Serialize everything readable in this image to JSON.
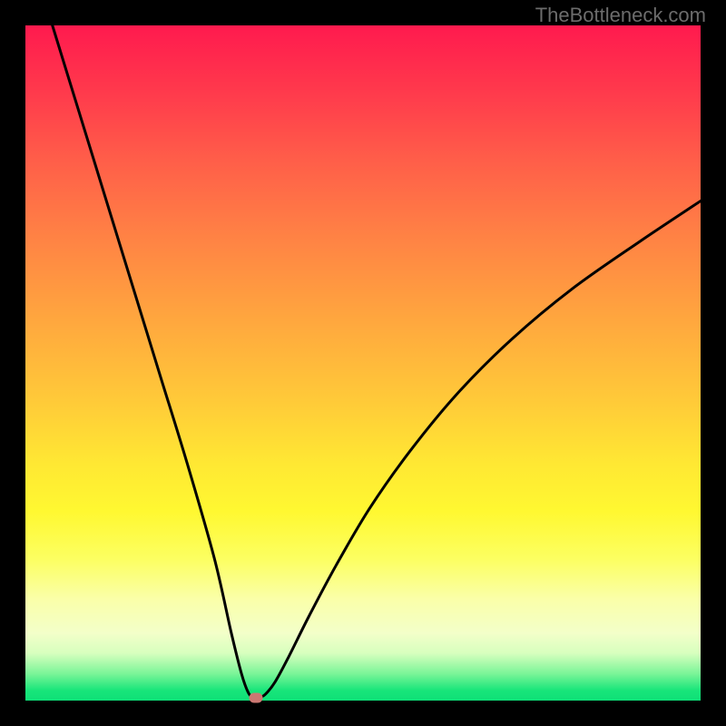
{
  "watermark": "TheBottleneck.com",
  "chart_data": {
    "type": "line",
    "title": "",
    "xlabel": "",
    "ylabel": "",
    "xlim": [
      0,
      100
    ],
    "ylim": [
      0,
      100
    ],
    "legend": false,
    "grid": false,
    "background": "rainbow-gradient-vertical",
    "series": [
      {
        "name": "bottleneck-curve",
        "x": [
          4,
          8,
          12,
          16,
          20,
          24,
          28,
          30.5,
          32,
          33,
          33.8,
          34.5,
          35.5,
          37,
          39,
          42,
          46,
          51,
          57,
          64,
          72,
          81,
          91,
          100
        ],
        "values": [
          100,
          87,
          74,
          61,
          48,
          35,
          21,
          10,
          4,
          1.2,
          0.4,
          0.4,
          0.9,
          2.8,
          6.5,
          12.5,
          20,
          28.5,
          37,
          45.5,
          53.5,
          61,
          68,
          74
        ],
        "stroke": "#000000",
        "stroke_width": 3
      }
    ],
    "marker": {
      "name": "optimal-point",
      "x": 34.2,
      "y": 0.4,
      "color": "#cb7772"
    }
  }
}
